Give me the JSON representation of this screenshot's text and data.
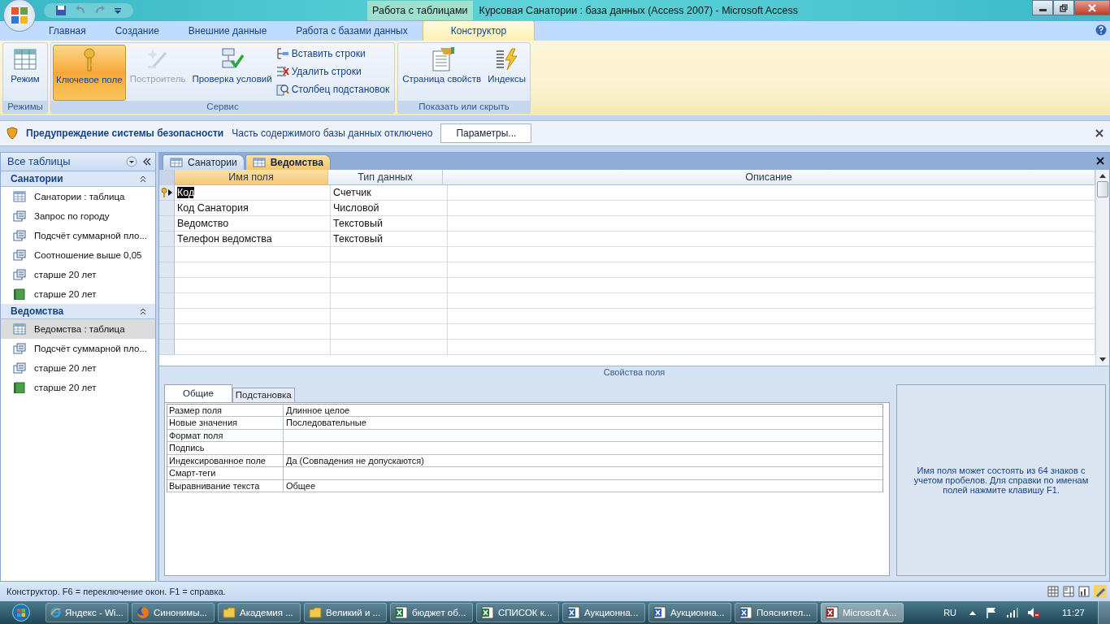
{
  "window": {
    "context": "Работа с таблицами",
    "title": "Курсовая Санатории : база данных (Access 2007)  -  Microsoft Access"
  },
  "ribbon_tabs": [
    {
      "label": "Главная",
      "selected": false
    },
    {
      "label": "Создание",
      "selected": false
    },
    {
      "label": "Внешние данные",
      "selected": false
    },
    {
      "label": "Работа с базами данных",
      "selected": false
    },
    {
      "label": "Конструктор",
      "selected": true
    }
  ],
  "ribbon_groups": [
    {
      "label": "Режимы",
      "buttons": [
        {
          "label": "Режим",
          "kind": "large",
          "active": false,
          "disabled": false
        }
      ]
    },
    {
      "label": "Сервис",
      "buttons": [
        {
          "label": "Ключевое поле",
          "kind": "large",
          "active": true,
          "disabled": false
        },
        {
          "label": "Построитель",
          "kind": "large",
          "active": false,
          "disabled": true
        },
        {
          "label": "Проверка условий",
          "kind": "large",
          "active": false,
          "disabled": false
        },
        {
          "label": "Вставить строки",
          "kind": "small",
          "active": false,
          "disabled": false
        },
        {
          "label": "Удалить строки",
          "kind": "small",
          "active": false,
          "disabled": false
        },
        {
          "label": "Столбец  подстановок",
          "kind": "small",
          "active": false,
          "disabled": false
        }
      ]
    },
    {
      "label": "Показать или скрыть",
      "buttons": [
        {
          "label": "Страница свойств",
          "kind": "large",
          "active": false,
          "disabled": false
        },
        {
          "label": "Индексы",
          "kind": "large",
          "active": false,
          "disabled": false
        }
      ]
    }
  ],
  "security_bar": {
    "title": "Предупреждение системы безопасности",
    "message": "Часть содержимого базы данных отключено",
    "button": "Параметры..."
  },
  "nav": {
    "header": "Все таблицы",
    "groups": [
      {
        "title": "Санатории",
        "items": [
          {
            "label": "Санатории : таблица",
            "kind": "table",
            "selected": false
          },
          {
            "label": "Запрос по городу",
            "kind": "query",
            "selected": false
          },
          {
            "label": "Подсчёт суммарной пло...",
            "kind": "query",
            "selected": false
          },
          {
            "label": "Соотношение выше 0,05",
            "kind": "query",
            "selected": false
          },
          {
            "label": "старше 20 лет",
            "kind": "query",
            "selected": false
          },
          {
            "label": "старше 20 лет",
            "kind": "report",
            "selected": false
          }
        ]
      },
      {
        "title": "Ведомства",
        "items": [
          {
            "label": "Ведомства : таблица",
            "kind": "table",
            "selected": true
          },
          {
            "label": "Подсчёт суммарной пло...",
            "kind": "query",
            "selected": false
          },
          {
            "label": "старше 20 лет",
            "kind": "query",
            "selected": false
          },
          {
            "label": "старше 20 лет",
            "kind": "report",
            "selected": false
          }
        ]
      }
    ]
  },
  "doc_tabs": [
    {
      "label": "Санатории",
      "selected": false
    },
    {
      "label": "Ведомства",
      "selected": true
    }
  ],
  "design_grid": {
    "columns": [
      {
        "label": "Имя поля",
        "selected": true
      },
      {
        "label": "Тип данных",
        "selected": false
      },
      {
        "label": "Описание",
        "selected": false
      }
    ],
    "rows": [
      {
        "name": "Код",
        "type": "Счетчик",
        "primary_key": true,
        "selected": true
      },
      {
        "name": "Код Санатория",
        "type": "Числовой",
        "primary_key": false,
        "selected": false
      },
      {
        "name": "Ведомство",
        "type": "Текстовый",
        "primary_key": false,
        "selected": false
      },
      {
        "name": "Телефон ведомства",
        "type": "Текстовый",
        "primary_key": false,
        "selected": false
      }
    ]
  },
  "field_properties": {
    "title": "Свойства поля",
    "tabs": [
      {
        "label": "Общие",
        "selected": true
      },
      {
        "label": "Подстановка",
        "selected": false
      }
    ],
    "rows": [
      {
        "label": "Размер поля",
        "value": "Длинное целое"
      },
      {
        "label": "Новые значения",
        "value": "Последовательные"
      },
      {
        "label": "Формат поля",
        "value": ""
      },
      {
        "label": "Подпись",
        "value": ""
      },
      {
        "label": "Индексированное поле",
        "value": "Да (Совпадения не допускаются)"
      },
      {
        "label": "Смарт-теги",
        "value": ""
      },
      {
        "label": "Выравнивание текста",
        "value": "Общее"
      }
    ],
    "help": "Имя поля может состоять из 64 знаков с учетом пробелов.  Для справки по именам полей нажмите клавишу F1."
  },
  "status_bar": "Конструктор.  F6 = переключение окон.  F1 = справка.",
  "taskbar": {
    "items": [
      {
        "label": "Яндекс - Wi...",
        "kind": "ie",
        "selected": false
      },
      {
        "label": "Синонимы...",
        "kind": "firefox",
        "selected": false
      },
      {
        "label": "Академия ...",
        "kind": "folder",
        "selected": false
      },
      {
        "label": "Великий и ...",
        "kind": "folder",
        "selected": false
      },
      {
        "label": "бюджет об...",
        "kind": "excel",
        "selected": false
      },
      {
        "label": "СПИСОК к...",
        "kind": "excel",
        "selected": false
      },
      {
        "label": "Аукционна...",
        "kind": "word",
        "selected": false
      },
      {
        "label": "Аукционна...",
        "kind": "word",
        "selected": false
      },
      {
        "label": "Пояснител...",
        "kind": "word",
        "selected": false
      },
      {
        "label": "Microsoft A...",
        "kind": "access",
        "selected": true
      }
    ],
    "language": "RU",
    "time": "11:27"
  }
}
